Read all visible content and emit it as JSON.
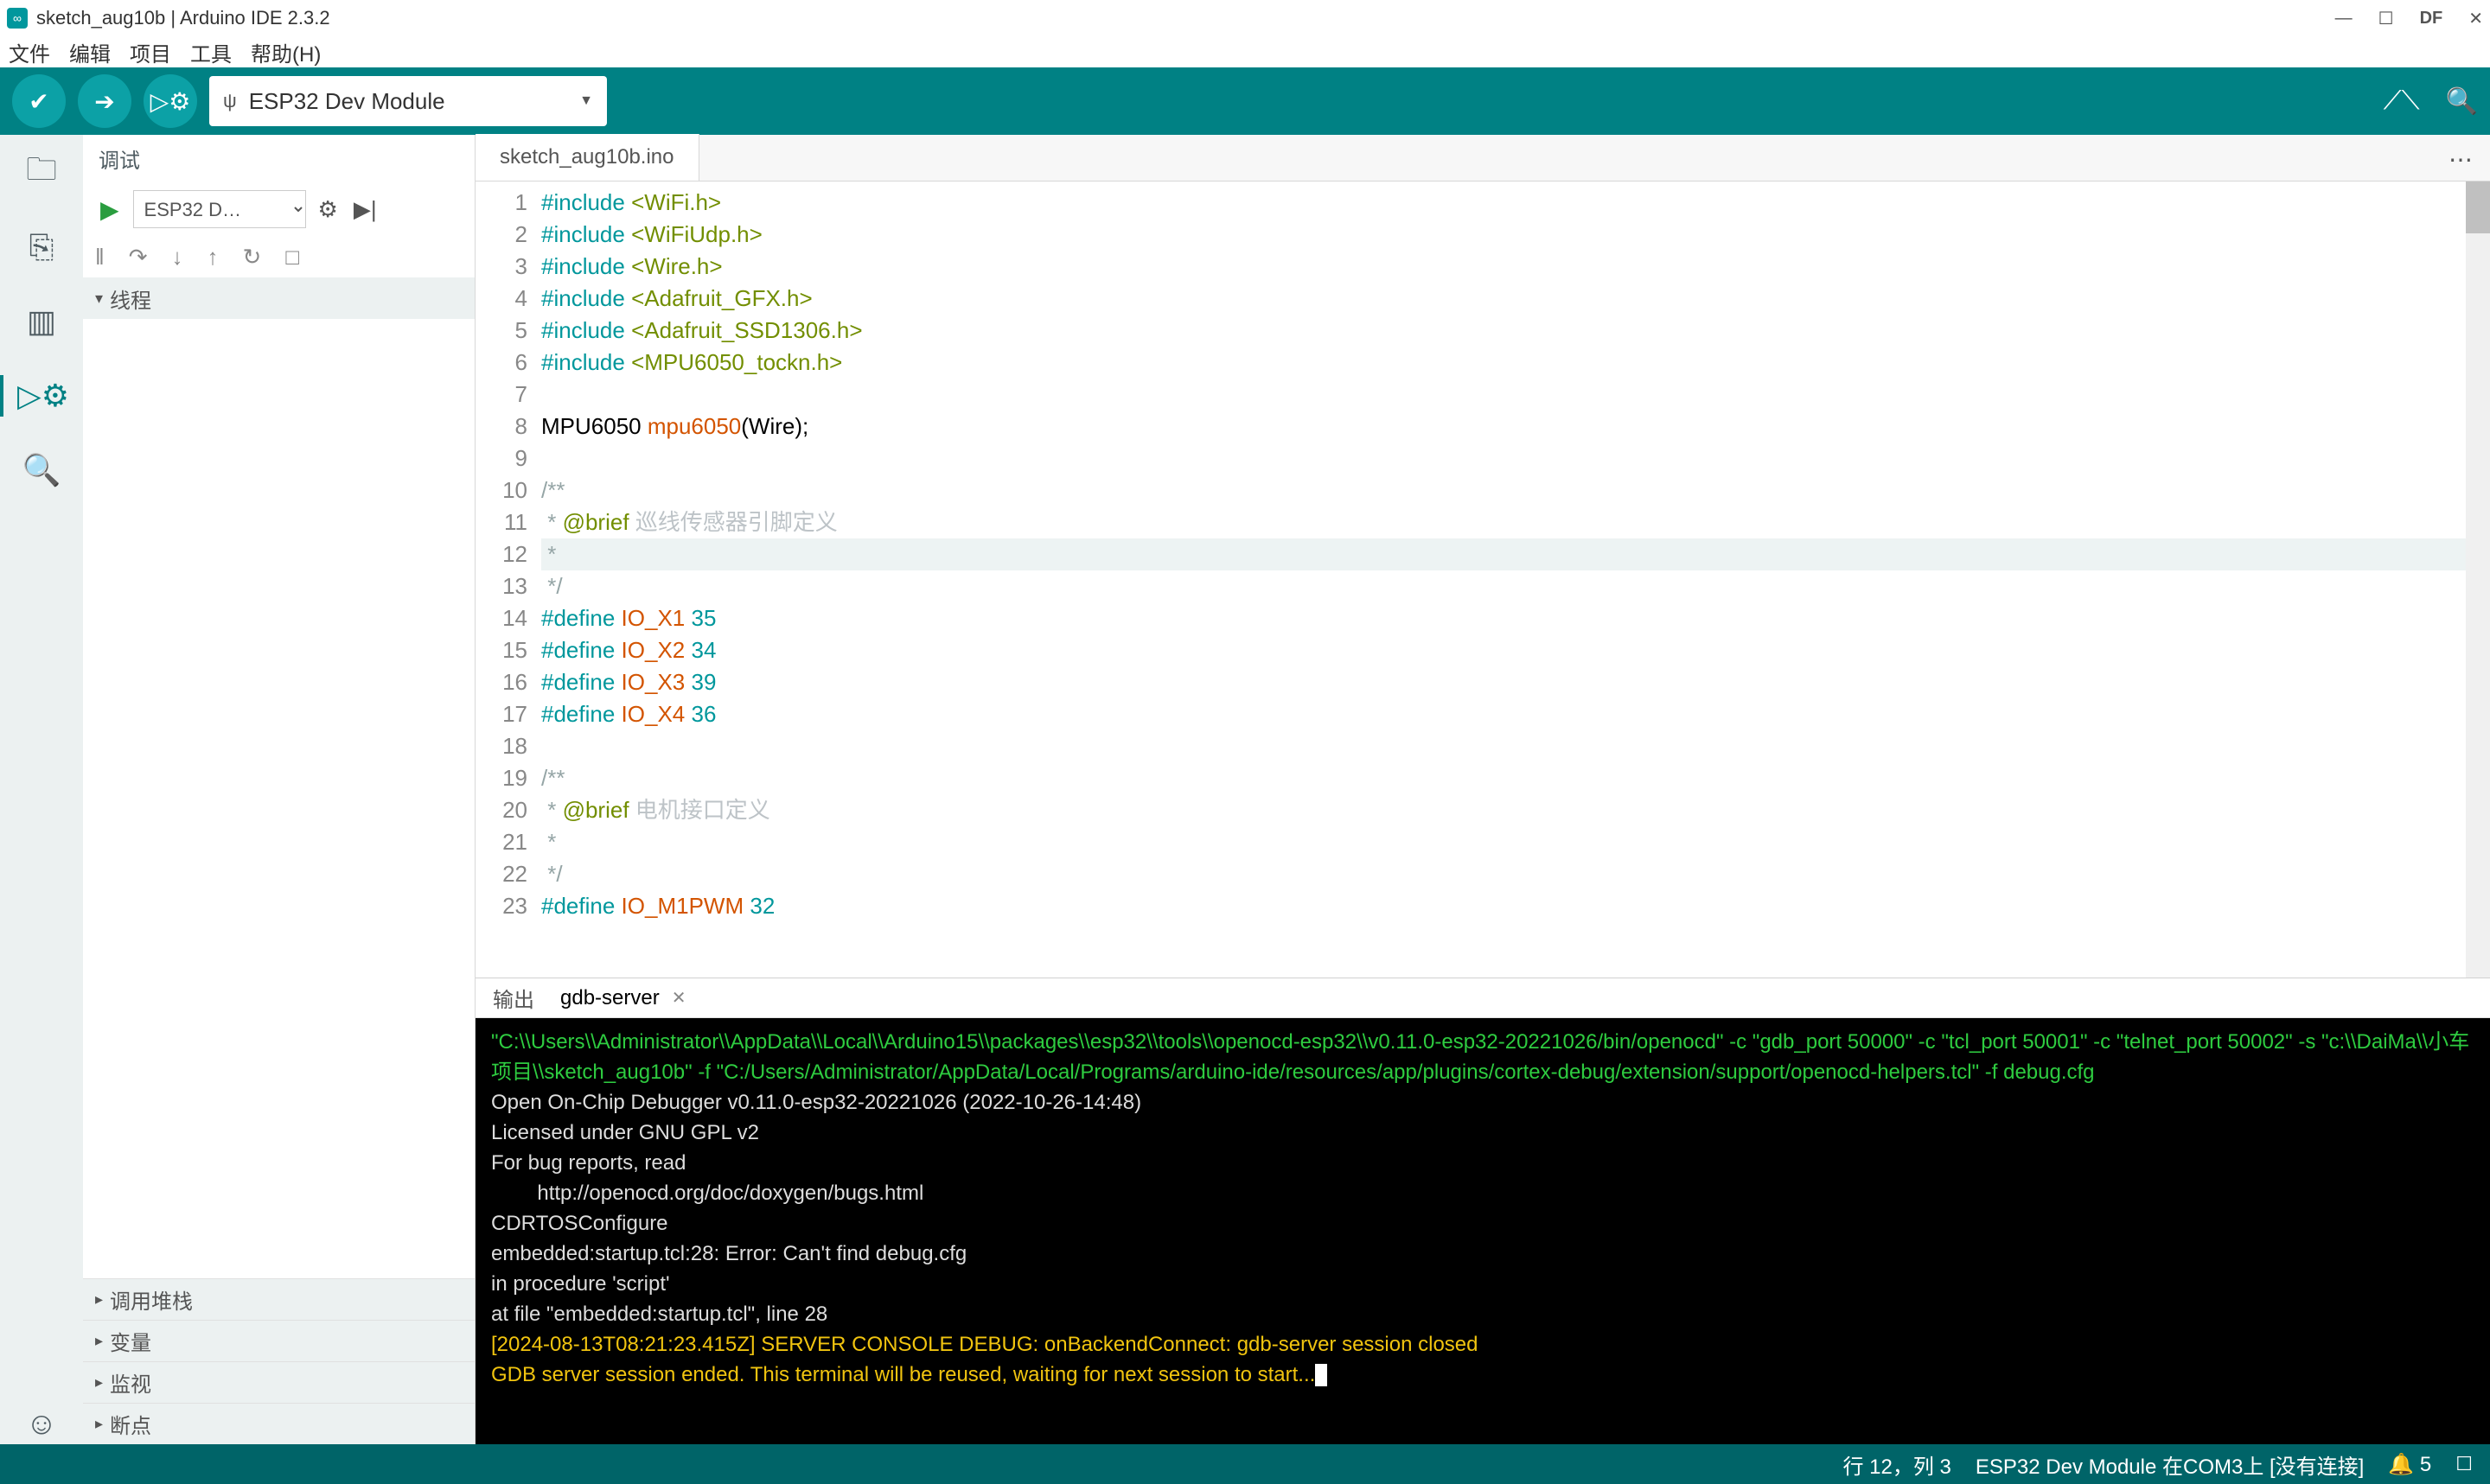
{
  "window": {
    "title": "sketch_aug10b | Arduino IDE 2.3.2"
  },
  "menu": {
    "file": "文件",
    "edit": "编辑",
    "sketch": "项目",
    "tools": "工具",
    "help": "帮助(H)"
  },
  "toolbar": {
    "board": "ESP32 Dev Module"
  },
  "sidepanel": {
    "title": "调试",
    "config": "ESP32 D…",
    "sections": {
      "threads": "线程",
      "callstack": "调用堆栈",
      "variables": "变量",
      "watch": "监视",
      "breakpoints": "断点"
    }
  },
  "editor": {
    "tab": "sketch_aug10b.ino",
    "lines": [
      {
        "n": 1,
        "html": "<span class='kw'>#include</span> <span class='inc'>&lt;WiFi.h&gt;</span>"
      },
      {
        "n": 2,
        "html": "<span class='kw'>#include</span> <span class='inc'>&lt;WiFiUdp.h&gt;</span>"
      },
      {
        "n": 3,
        "html": "<span class='kw'>#include</span> <span class='inc'>&lt;Wire.h&gt;</span>"
      },
      {
        "n": 4,
        "html": "<span class='kw'>#include</span> <span class='inc'>&lt;Adafruit_GFX.h&gt;</span>"
      },
      {
        "n": 5,
        "html": "<span class='kw'>#include</span> <span class='inc'>&lt;Adafruit_SSD1306.h&gt;</span>"
      },
      {
        "n": 6,
        "html": "<span class='kw'>#include</span> <span class='inc'>&lt;MPU6050_tockn.h&gt;</span>"
      },
      {
        "n": 7,
        "html": ""
      },
      {
        "n": 8,
        "html": "MPU6050 <span class='fn'>mpu6050</span>(Wire);"
      },
      {
        "n": 9,
        "html": ""
      },
      {
        "n": 10,
        "html": "<span class='cmt'>/**</span>"
      },
      {
        "n": 11,
        "html": "<span class='cmt'> * </span><span class='brief'>@brief</span> <span class='cmt2'>巡线传感器引脚定义</span>"
      },
      {
        "n": 12,
        "html": "<span class='cmt'> * </span>",
        "hl": true
      },
      {
        "n": 13,
        "html": "<span class='cmt'> */</span>"
      },
      {
        "n": 14,
        "html": "<span class='kw'>#define</span> <span class='ident'>IO_X1</span> <span class='num'>35</span>"
      },
      {
        "n": 15,
        "html": "<span class='kw'>#define</span> <span class='ident'>IO_X2</span> <span class='num'>34</span>"
      },
      {
        "n": 16,
        "html": "<span class='kw'>#define</span> <span class='ident'>IO_X3</span> <span class='num'>39</span>"
      },
      {
        "n": 17,
        "html": "<span class='kw'>#define</span> <span class='ident'>IO_X4</span> <span class='num'>36</span>"
      },
      {
        "n": 18,
        "html": ""
      },
      {
        "n": 19,
        "html": "<span class='cmt'>/**</span>"
      },
      {
        "n": 20,
        "html": "<span class='cmt'> * </span><span class='brief'>@brief</span> <span class='cmt2'>电机接口定义</span>"
      },
      {
        "n": 21,
        "html": "<span class='cmt'> * </span>"
      },
      {
        "n": 22,
        "html": "<span class='cmt'> */</span>"
      },
      {
        "n": 23,
        "html": "<span class='kw'>#define</span> <span class='ident'>IO_M1PWM</span> <span class='num'>32</span>"
      }
    ]
  },
  "terminal": {
    "tabs": {
      "output": "输出",
      "gdb": "gdb-server"
    },
    "lines": [
      {
        "cls": "tg",
        "t": "\"C:\\\\Users\\\\Administrator\\\\AppData\\\\Local\\\\Arduino15\\\\packages\\\\esp32\\\\tools\\\\openocd-esp32\\\\v0.11.0-esp32-20221026/bin/openocd\" -c \"gdb_port 50000\" -c \"tcl_port 50001\" -c \"telnet_port 50002\" -s \"c:\\\\DaiMa\\\\小车项目\\\\sketch_aug10b\" -f \"C:/Users/Administrator/AppData/Local/Programs/arduino-ide/resources/app/plugins/cortex-debug/extension/support/openocd-helpers.tcl\" -f debug.cfg"
      },
      {
        "cls": "tw",
        "t": "Open On-Chip Debugger v0.11.0-esp32-20221026 (2022-10-26-14:48)"
      },
      {
        "cls": "tw",
        "t": "Licensed under GNU GPL v2"
      },
      {
        "cls": "tw",
        "t": "For bug reports, read"
      },
      {
        "cls": "tw",
        "t": "        http://openocd.org/doc/doxygen/bugs.html"
      },
      {
        "cls": "tw",
        "t": "CDRTOSConfigure"
      },
      {
        "cls": "tw",
        "t": "embedded:startup.tcl:28: Error: Can't find debug.cfg"
      },
      {
        "cls": "tw",
        "t": "in procedure 'script'"
      },
      {
        "cls": "tw",
        "t": "at file \"embedded:startup.tcl\", line 28"
      },
      {
        "cls": "ty",
        "t": "[2024-08-13T08:21:23.415Z] SERVER CONSOLE DEBUG: onBackendConnect: gdb-server session closed"
      },
      {
        "cls": "ty",
        "t": "GDB server session ended. This terminal will be reused, waiting for next session to start..."
      }
    ]
  },
  "status": {
    "pos": "行 12，列 3",
    "board": "ESP32 Dev Module 在COM3上 [没有连接]",
    "notif": "5"
  }
}
